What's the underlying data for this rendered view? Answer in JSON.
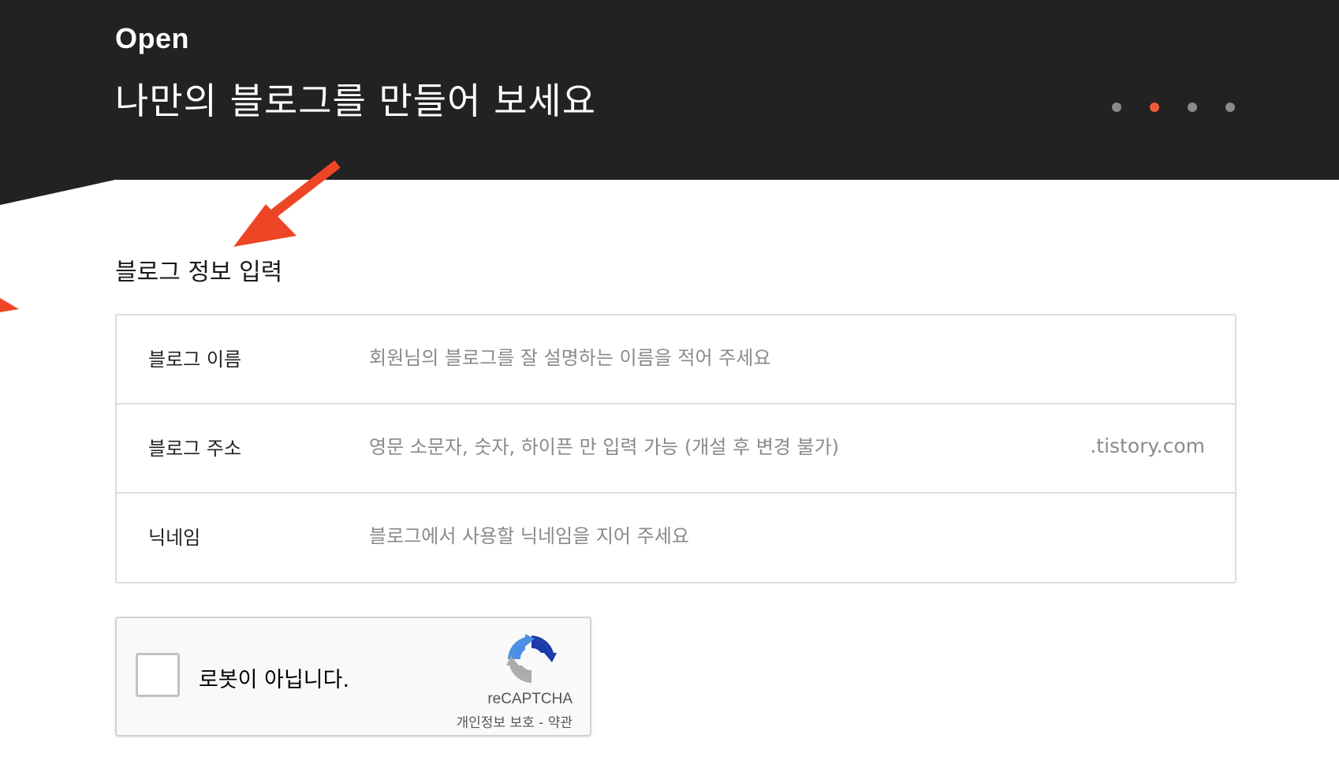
{
  "header": {
    "brand": "Open",
    "headline": "나만의 블로그를 만들어 보세요",
    "dots_total": 4,
    "dots_active_index": 1
  },
  "form": {
    "title": "블로그 정보 입력",
    "rows": [
      {
        "label": "블로그 이름",
        "placeholder": "회원님의 블로그를 잘 설명하는 이름을 적어 주세요",
        "value": ""
      },
      {
        "label": "블로그 주소",
        "placeholder": "영문 소문자, 숫자, 하이픈 만 입력 가능 (개설 후 변경 불가)",
        "value": "",
        "suffix": ".tistory.com"
      },
      {
        "label": "닉네임",
        "placeholder": "블로그에서 사용할 닉네임을 지어 주세요",
        "value": ""
      }
    ]
  },
  "captcha": {
    "checkbox_label": "로봇이 아닙니다.",
    "brand": "reCAPTCHA",
    "privacy_link": "개인정보 보호",
    "separator": "-",
    "terms_link": "약관",
    "checked": false
  },
  "colors": {
    "header_bg": "#222222",
    "accent": "#f05a3c",
    "dot_inactive": "#8a8a8a",
    "border": "#dcdcdc"
  }
}
